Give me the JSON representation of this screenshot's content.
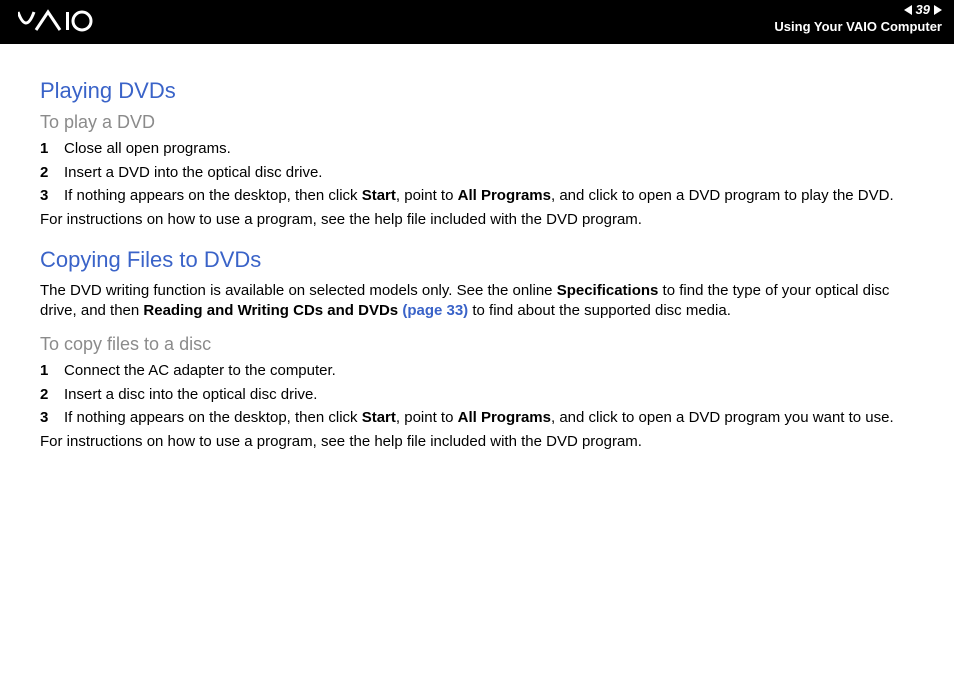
{
  "header": {
    "page_number": "39",
    "chapter": "Using Your VAIO Computer"
  },
  "section1": {
    "title": "Playing DVDs",
    "subtitle": "To play a DVD",
    "steps": [
      "Close all open programs.",
      "Insert a DVD into the optical disc drive.",
      {
        "pre": "If nothing appears on the desktop, then click ",
        "b1": "Start",
        "mid1": ", point to ",
        "b2": "All Programs",
        "post": ", and click to open a DVD program to play the DVD."
      }
    ],
    "footnote": "For instructions on how to use a program, see the help file included with the DVD program."
  },
  "section2": {
    "title": "Copying Files to DVDs",
    "intro": {
      "pre": "The DVD writing function is available on selected models only. See the online ",
      "b1": "Specifications",
      "mid1": " to find the type of your optical disc drive, and then ",
      "b2": "Reading and Writing CDs and DVDs ",
      "link": "(page 33)",
      "post": " to find about the supported disc media."
    },
    "subtitle": "To copy files to a disc",
    "steps": [
      "Connect the AC adapter to the computer.",
      "Insert a disc into the optical disc drive.",
      {
        "pre": "If nothing appears on the desktop, then click ",
        "b1": "Start",
        "mid1": ", point to ",
        "b2": "All Programs",
        "post": ", and click to open a DVD program you want to use."
      }
    ],
    "footnote": "For instructions on how to use a program, see the help file included with the DVD program."
  }
}
